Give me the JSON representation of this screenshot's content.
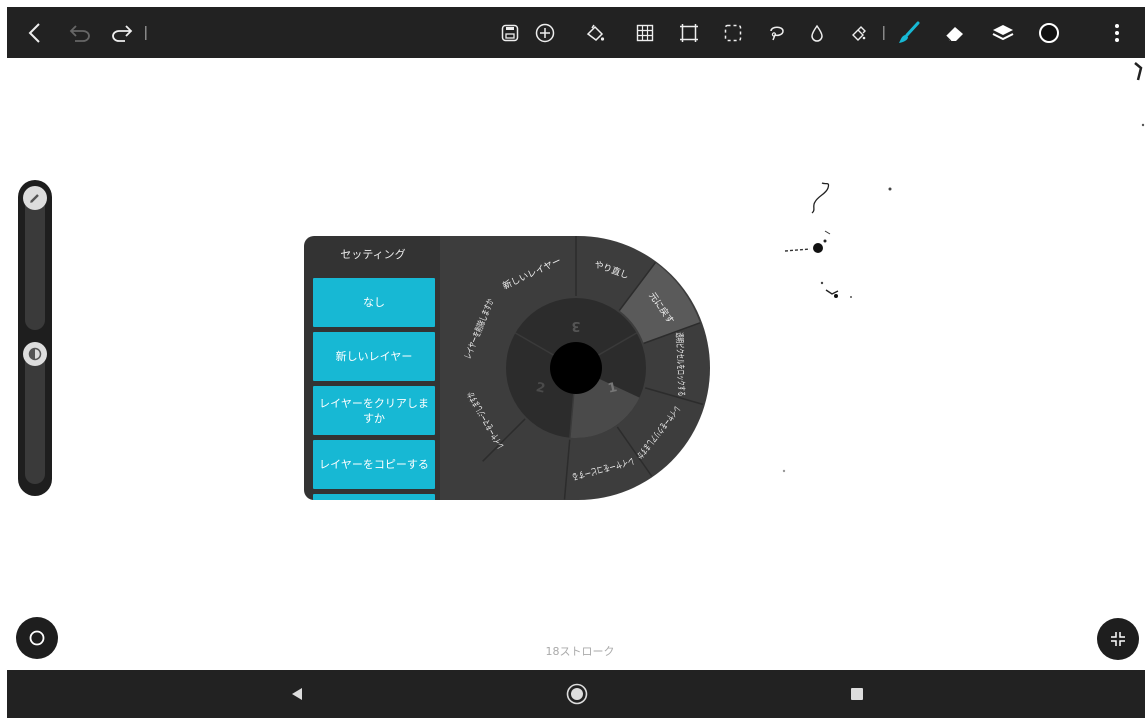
{
  "toolbar": {
    "icons": [
      "back-icon",
      "undo-icon",
      "redo-icon",
      "save-icon",
      "add-icon",
      "fill-icon",
      "grid-icon",
      "crop-icon",
      "selection-icon",
      "lasso-icon",
      "water-drop-icon",
      "stamp-icon",
      "brush-icon",
      "eraser-icon",
      "layers-icon",
      "color-icon",
      "more-icon"
    ],
    "accent": "#17b8d4"
  },
  "panel": {
    "title": "セッティング",
    "buttons": [
      "なし",
      "新しいレイヤー",
      "レイヤーをクリアしますか",
      "レイヤーをコピーする"
    ]
  },
  "dial": {
    "segments": [
      "やり直し",
      "元に戻す",
      "透明ピクセルをロックする",
      "レイヤーをクリアしますか",
      "レイヤーをコピーする",
      "レイヤーをマージしますか",
      "レイヤーを削除しますか",
      "新しいレイヤー"
    ],
    "ring_numbers": [
      "3",
      "1",
      "2"
    ]
  },
  "status": {
    "strokes": "18ストローク"
  },
  "nav": {
    "icons": [
      "nav-back-icon",
      "nav-home-icon",
      "nav-recents-icon"
    ]
  }
}
